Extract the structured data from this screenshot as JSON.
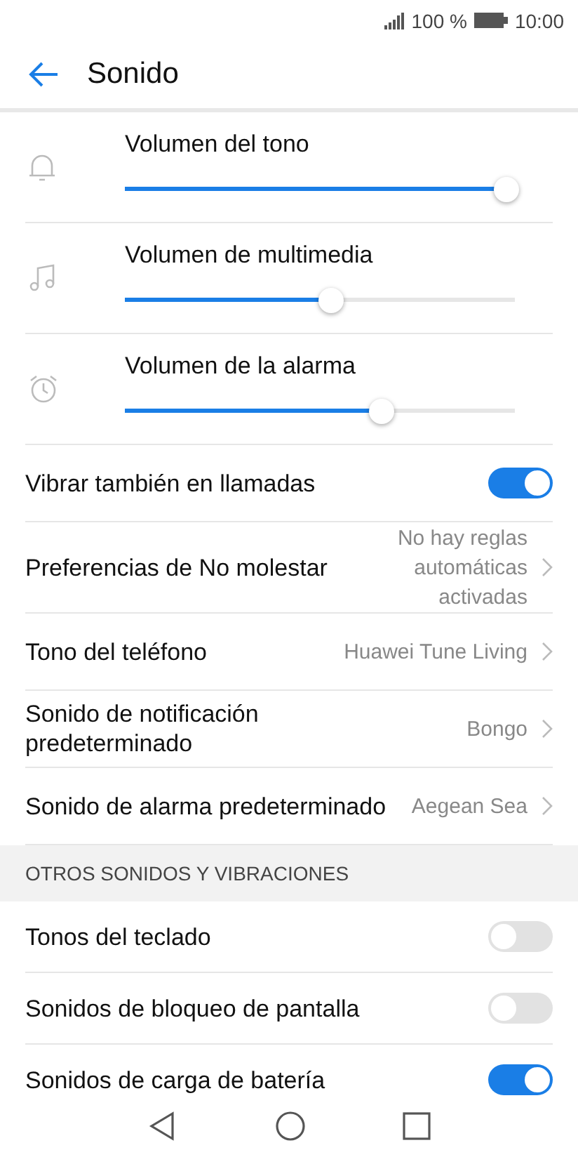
{
  "status_bar": {
    "battery_text": "100 %",
    "time": "10:00"
  },
  "header": {
    "title": "Sonido"
  },
  "volumes": [
    {
      "kind": "bell",
      "label": "Volumen del tono",
      "level": 0.98
    },
    {
      "kind": "note",
      "label": "Volumen de multimedia",
      "level": 0.53
    },
    {
      "kind": "alarm",
      "label": "Volumen de la alarma",
      "level": 0.66
    }
  ],
  "settings": [
    {
      "kind": "toggle",
      "label": "Vibrar también en llamadas",
      "on": true
    },
    {
      "kind": "link",
      "label": "Preferencias de No molestar",
      "value": "No hay reglas automáticas activadas"
    },
    {
      "kind": "link",
      "label": "Tono del teléfono",
      "value": "Huawei Tune Living"
    },
    {
      "kind": "link",
      "label": "Sonido de notificación predeterminado",
      "value": "Bongo"
    },
    {
      "kind": "link",
      "label": "Sonido de alarma predeterminado",
      "value": "Aegean Sea"
    }
  ],
  "section": {
    "title": "OTROS SONIDOS Y VIBRACIONES",
    "items": [
      {
        "kind": "toggle",
        "label": "Tonos del teclado",
        "on": false
      },
      {
        "kind": "toggle",
        "label": "Sonidos de bloqueo de pantalla",
        "on": false
      },
      {
        "kind": "toggle",
        "label": "Sonidos de carga de batería",
        "on": true
      }
    ]
  }
}
